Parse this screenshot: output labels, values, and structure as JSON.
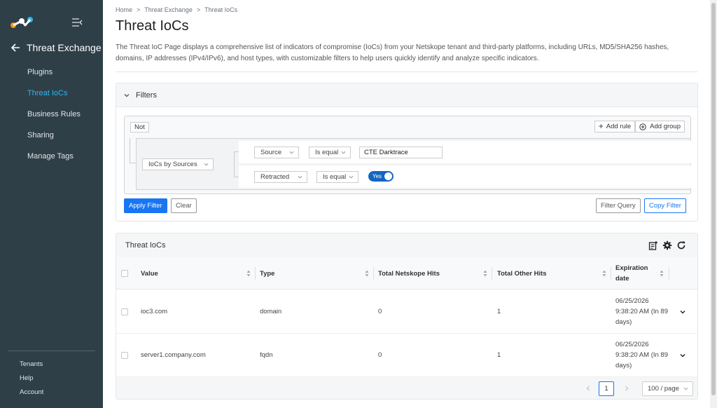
{
  "sidebar": {
    "back_title": "Threat Exchange",
    "items": [
      {
        "label": "Plugins",
        "active": false
      },
      {
        "label": "Threat IoCs",
        "active": true
      },
      {
        "label": "Business Rules",
        "active": false
      },
      {
        "label": "Sharing",
        "active": false
      },
      {
        "label": "Manage Tags",
        "active": false
      }
    ],
    "bottom": [
      "Tenants",
      "Help",
      "Account"
    ]
  },
  "breadcrumb": [
    "Home",
    "Threat Exchange",
    "Threat IoCs"
  ],
  "page": {
    "title": "Threat IoCs",
    "description": "The Threat IoC Page displays a comprehensive list of indicators of compromise (IoCs) from your Netskope tenant and third-party platforms, including URLs, MD5/SHA256 hashes, domains, IP addresses (IPv4/IPv6), and host types, with customizable filters to help users quickly identify and analyze specific indicators."
  },
  "filters": {
    "title": "Filters",
    "not_label": "Not",
    "add_rule": "Add rule",
    "add_group": "Add group",
    "group_field": "IoCs by Sources",
    "rules": [
      {
        "field": "Source",
        "operator": "Is equal",
        "value": "CTE Darktrace"
      },
      {
        "field": "Retracted",
        "operator": "Is equal",
        "value": "Yes"
      }
    ],
    "apply": "Apply Filter",
    "clear": "Clear",
    "filter_query": "Filter Query",
    "copy_filter": "Copy Filter"
  },
  "table": {
    "title": "Threat IoCs",
    "columns": [
      "Value",
      "Type",
      "Total Netskope Hits",
      "Total Other Hits",
      "Expiration date"
    ],
    "rows": [
      {
        "value": "ioc3.com",
        "type": "domain",
        "netskope_hits": "0",
        "other_hits": "1",
        "expiration": "06/25/2026 9:38:20 AM (In 89 days)"
      },
      {
        "value": "server1.company.com",
        "type": "fqdn",
        "netskope_hits": "0",
        "other_hits": "1",
        "expiration": "06/25/2026 9:38:20 AM (In 89 days)"
      }
    ],
    "pagination": {
      "current_page": "1",
      "page_size": "100 / page"
    }
  },
  "colors": {
    "sidebar_bg": "#2f3f48",
    "accent": "#1976f2",
    "active_nav": "#29b6f6"
  }
}
